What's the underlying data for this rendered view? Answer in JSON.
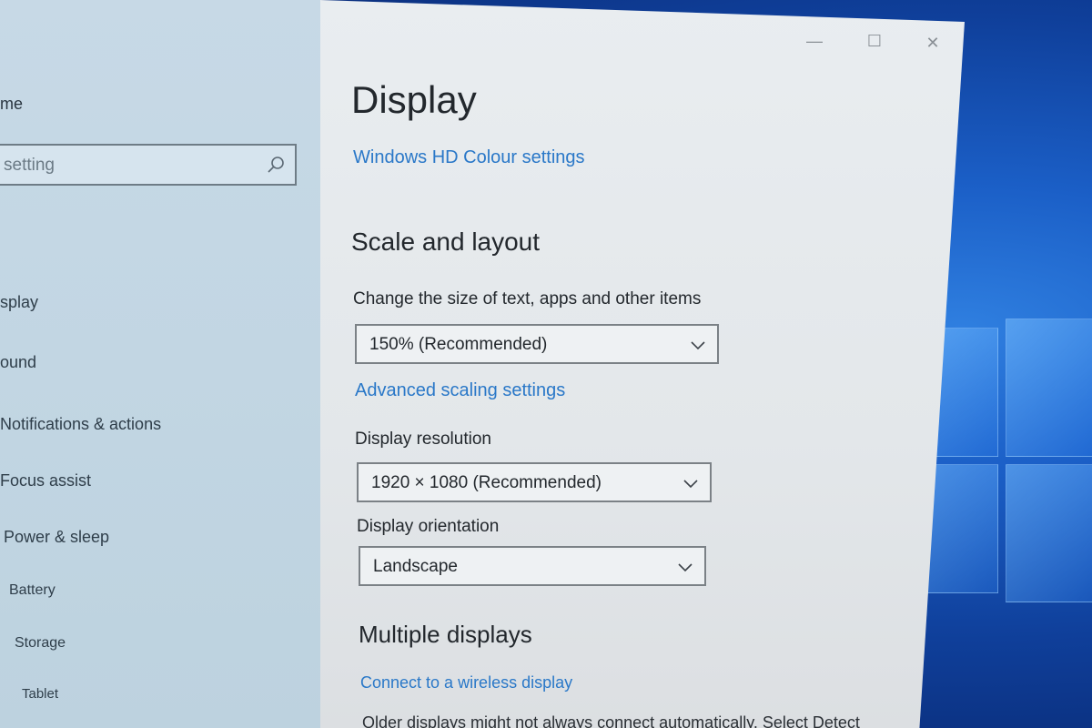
{
  "sidebar": {
    "home_label": "me",
    "search_placeholder": "setting",
    "items": [
      {
        "label": "splay"
      },
      {
        "label": "ound"
      },
      {
        "label": "Notifications & actions"
      },
      {
        "label": "Focus assist"
      },
      {
        "label": "Power & sleep"
      },
      {
        "label": "Battery"
      },
      {
        "label": "Storage"
      },
      {
        "label": "Tablet"
      }
    ]
  },
  "window": {
    "minimize": "—",
    "maximize": "☐",
    "close": "✕"
  },
  "main": {
    "title": "Display",
    "hd_colour_link": "Windows HD Colour settings",
    "scale_section": {
      "heading": "Scale and layout",
      "size_label": "Change the size of text, apps and other items",
      "size_value": "150% (Recommended)",
      "advanced_link": "Advanced scaling settings",
      "resolution_label": "Display resolution",
      "resolution_value": "1920 × 1080 (Recommended)",
      "orientation_label": "Display orientation",
      "orientation_value": "Landscape"
    },
    "multiple_section": {
      "heading": "Multiple displays",
      "wireless_link": "Connect to a wireless display",
      "note": "Older displays might not always connect automatically. Select Detect"
    }
  },
  "colors": {
    "link": "#2a78c8",
    "desktop_blue": "#1b5fc7"
  }
}
